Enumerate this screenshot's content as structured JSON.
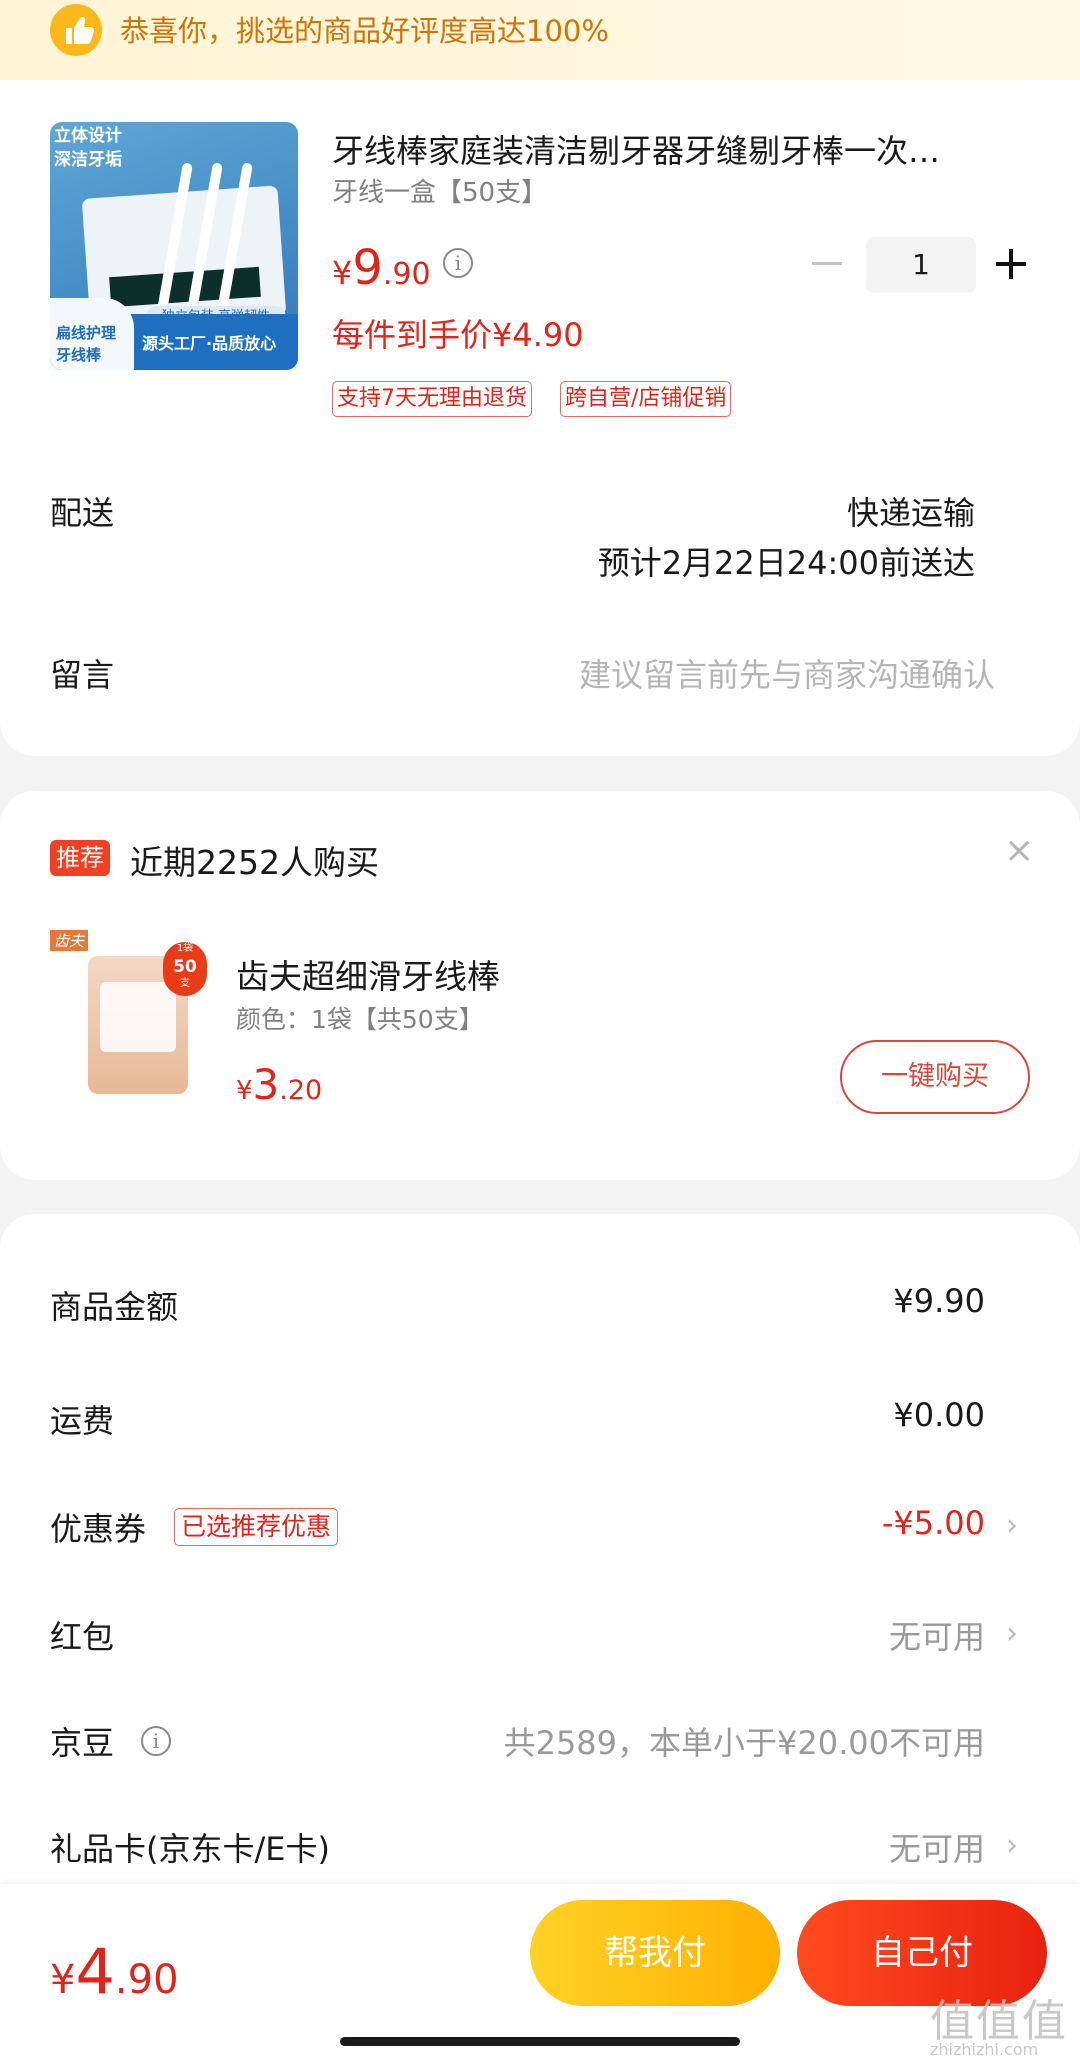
{
  "banner": {
    "text": "恭喜你，挑选的商品好评度高达100%"
  },
  "product": {
    "image_labels": {
      "top": "立体设计\n深洁牙垢",
      "corner": "扁线护理\n牙线棒",
      "ribbon": "源头工厂·品质放心",
      "pill": "独立包装 高弹韧性"
    },
    "title": "牙线棒家庭装清洁剔牙器牙缝剔牙棒一次…",
    "spec": "牙线一盒【50支】",
    "price": {
      "symbol": "¥",
      "int": "9",
      "dec": ".90"
    },
    "unit_price": "每件到手价¥4.90",
    "quantity": "1",
    "tags": [
      "支持7天无理由退货",
      "跨自营/店铺促销"
    ]
  },
  "delivery": {
    "label": "配送",
    "method": "快递运输",
    "eta": "预计2月22日24:00前送达"
  },
  "message": {
    "label": "留言",
    "placeholder": "建议留言前先与商家沟通确认"
  },
  "recommend": {
    "badge": "推荐",
    "title": "近期2252人购买",
    "close": "×",
    "image": {
      "brand": "齿夫",
      "b1": "1袋",
      "b2": "50",
      "b3": "支"
    },
    "name": "齿夫超细滑牙线棒",
    "spec": "颜色：1袋【共50支】",
    "price": {
      "symbol": "¥",
      "int": "3",
      "dec": ".20"
    },
    "buy_label": "一键购买"
  },
  "summary": {
    "goods_label": "商品金额",
    "goods_value": "¥9.90",
    "shipping_label": "运费",
    "shipping_value": "¥0.00",
    "coupon_label": "优惠券",
    "coupon_tag": "已选推荐优惠",
    "coupon_value": "-¥5.00",
    "redpacket_label": "红包",
    "redpacket_value": "无可用",
    "jingdou_label": "京豆",
    "jingdou_value": "共2589，本单小于¥20.00不可用",
    "giftcard_label": "礼品卡(京东卡/E卡)",
    "giftcard_value": "无可用"
  },
  "footer": {
    "total": {
      "symbol": "¥",
      "int": "4",
      "dec": ".90"
    },
    "help_pay": "帮我付",
    "self_pay": "自己付",
    "watermark": "值值值",
    "watermark_url": "zhizhizhi.com"
  },
  "colors": {
    "accent_red": "#e2231a",
    "banner_text": "#d07400",
    "yellow_btn": "#ffc10e",
    "red_btn": "#f0301a"
  }
}
